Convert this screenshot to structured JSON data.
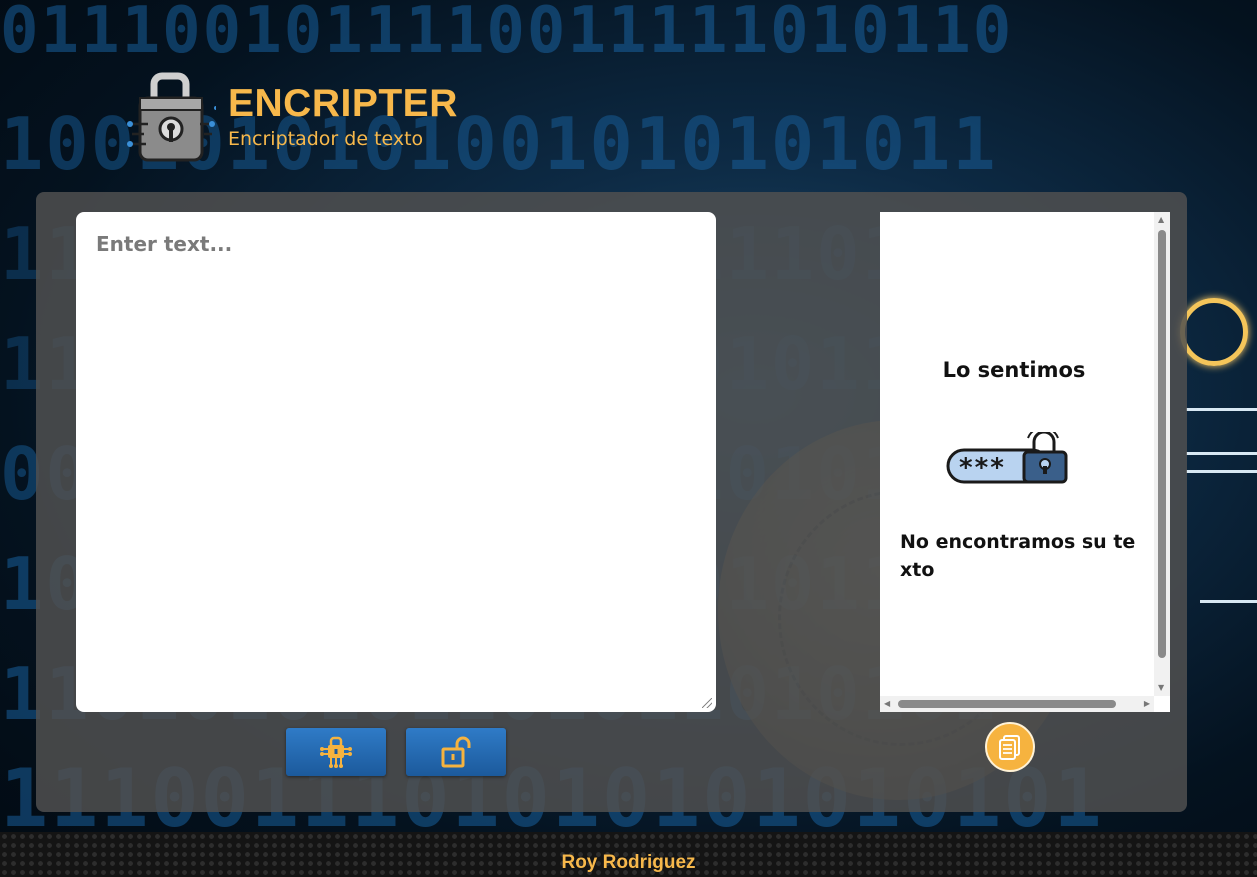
{
  "background": {
    "binary_rows": [
      "0111001011110011111010110",
      "1001010101001010101011",
      "1101001011100101110101",
      "1101011100111010101110",
      "0011010101110101010110",
      "1010101110101010101101",
      "1101010101101011010101",
      "1110011101010101010101"
    ]
  },
  "header": {
    "title": "ENCRIPTER",
    "subtitle": "Encriptador de texto",
    "logo_icon": "lock-circuit-icon"
  },
  "input": {
    "placeholder": "Enter text...",
    "value": ""
  },
  "buttons": {
    "encrypt_icon": "encrypt-chip-icon",
    "decrypt_icon": "unlock-icon"
  },
  "output": {
    "title": "Lo sentimos",
    "image_icon": "password-lock-icon",
    "message": "No encontramos su texto",
    "copy_icon": "copy-icon"
  },
  "footer": {
    "author": "Roy Rodriguez"
  },
  "colors": {
    "accent": "#f7b84b",
    "button_blue": "#2a6fb5",
    "panel": "#505050"
  }
}
